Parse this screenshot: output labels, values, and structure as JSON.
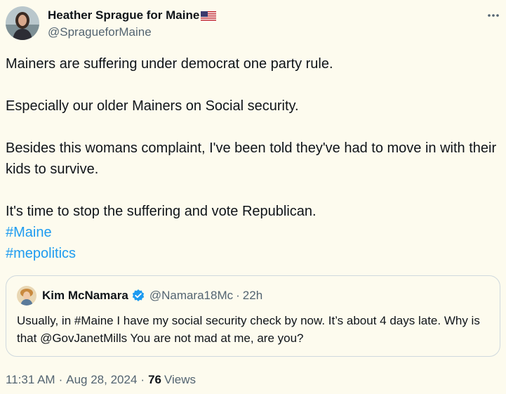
{
  "author": {
    "display_name": "Heather Sprague for Maine",
    "flag_icon": "us-flag-icon",
    "handle": "@SpragueforMaine"
  },
  "more_icon": "more-horizontal-icon",
  "tweet": {
    "paragraphs": [
      "Mainers are suffering under democrat one party rule.",
      "Especially our older Mainers on Social security.",
      "Besides this womans complaint, I've been told they've had to move in with their kids to survive.",
      "It's time to stop the suffering and vote Republican."
    ],
    "hashtags": [
      "#Maine",
      "#mepolitics"
    ]
  },
  "quote": {
    "name": "Kim McNamara",
    "verified_icon": "verified-badge-icon",
    "handle": "@Namara18Mc",
    "separator": "·",
    "time": "22h",
    "text": "Usually, in #Maine I have my social security check by now.  It’s about 4 days late.  Why is that @GovJanetMills   You are  not mad at me, are you?"
  },
  "meta": {
    "time": "11:31 AM",
    "separator": "·",
    "date": "Aug 28, 2024",
    "views_count": "76",
    "views_label": "Views"
  },
  "colors": {
    "background": "#fdfbee",
    "text": "#0f1419",
    "secondary": "#536471",
    "link": "#1d9bf0",
    "border": "#cfd9de",
    "verified": "#1d9bf0"
  }
}
